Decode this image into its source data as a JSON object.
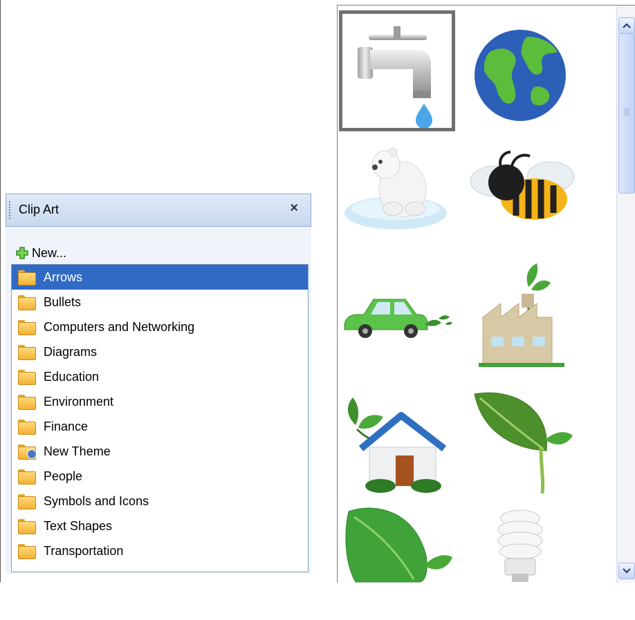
{
  "panel": {
    "title": "Clip Art",
    "close_glyph": "×",
    "new_label": "New...",
    "folders": [
      {
        "label": "Arrows",
        "icon": "folder-icon",
        "selected": true
      },
      {
        "label": "Bullets",
        "icon": "folder-icon"
      },
      {
        "label": "Computers and Networking",
        "icon": "folder-icon"
      },
      {
        "label": "Diagrams",
        "icon": "folder-icon"
      },
      {
        "label": "Education",
        "icon": "folder-icon"
      },
      {
        "label": "Environment",
        "icon": "folder-icon"
      },
      {
        "label": "Finance",
        "icon": "folder-icon"
      },
      {
        "label": "New Theme",
        "icon": "user-folder-icon"
      },
      {
        "label": "People",
        "icon": "folder-icon"
      },
      {
        "label": "Symbols and Icons",
        "icon": "folder-icon"
      },
      {
        "label": "Text Shapes",
        "icon": "folder-icon"
      },
      {
        "label": "Transportation",
        "icon": "folder-icon"
      }
    ]
  },
  "gallery": {
    "items": [
      "faucet-clipart",
      "globe-clipart",
      "polar-bear-clipart",
      "bee-clipart",
      "green-car-clipart",
      "factory-clipart",
      "eco-house-clipart",
      "green-leaf-clipart",
      "leaf-clipart",
      "cfl-bulb-clipart"
    ],
    "selected_item": "faucet-clipart"
  },
  "colors": {
    "selection": "#316ac5",
    "header": "#c9d9ef"
  }
}
